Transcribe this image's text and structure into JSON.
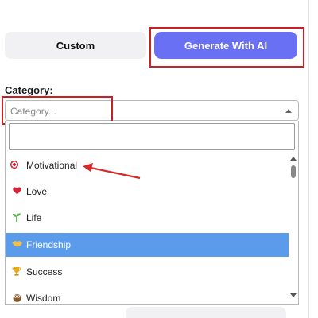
{
  "tabs": {
    "custom_label": "Custom",
    "ai_label": "Generate With AI"
  },
  "category": {
    "label": "Category:",
    "placeholder": "Category...",
    "search_value": "",
    "options": [
      {
        "icon": "target-icon",
        "label": "Motivational"
      },
      {
        "icon": "heart-icon",
        "label": "Love"
      },
      {
        "icon": "seedling-icon",
        "label": "Life"
      },
      {
        "icon": "handshake-icon",
        "label": "Friendship",
        "selected": true
      },
      {
        "icon": "trophy-icon",
        "label": "Success"
      },
      {
        "icon": "owl-icon",
        "label": "Wisdom"
      }
    ]
  },
  "colors": {
    "accent": "#6970f3",
    "highlight": "#5b9bec",
    "annotation_red": "#cc1f24"
  }
}
